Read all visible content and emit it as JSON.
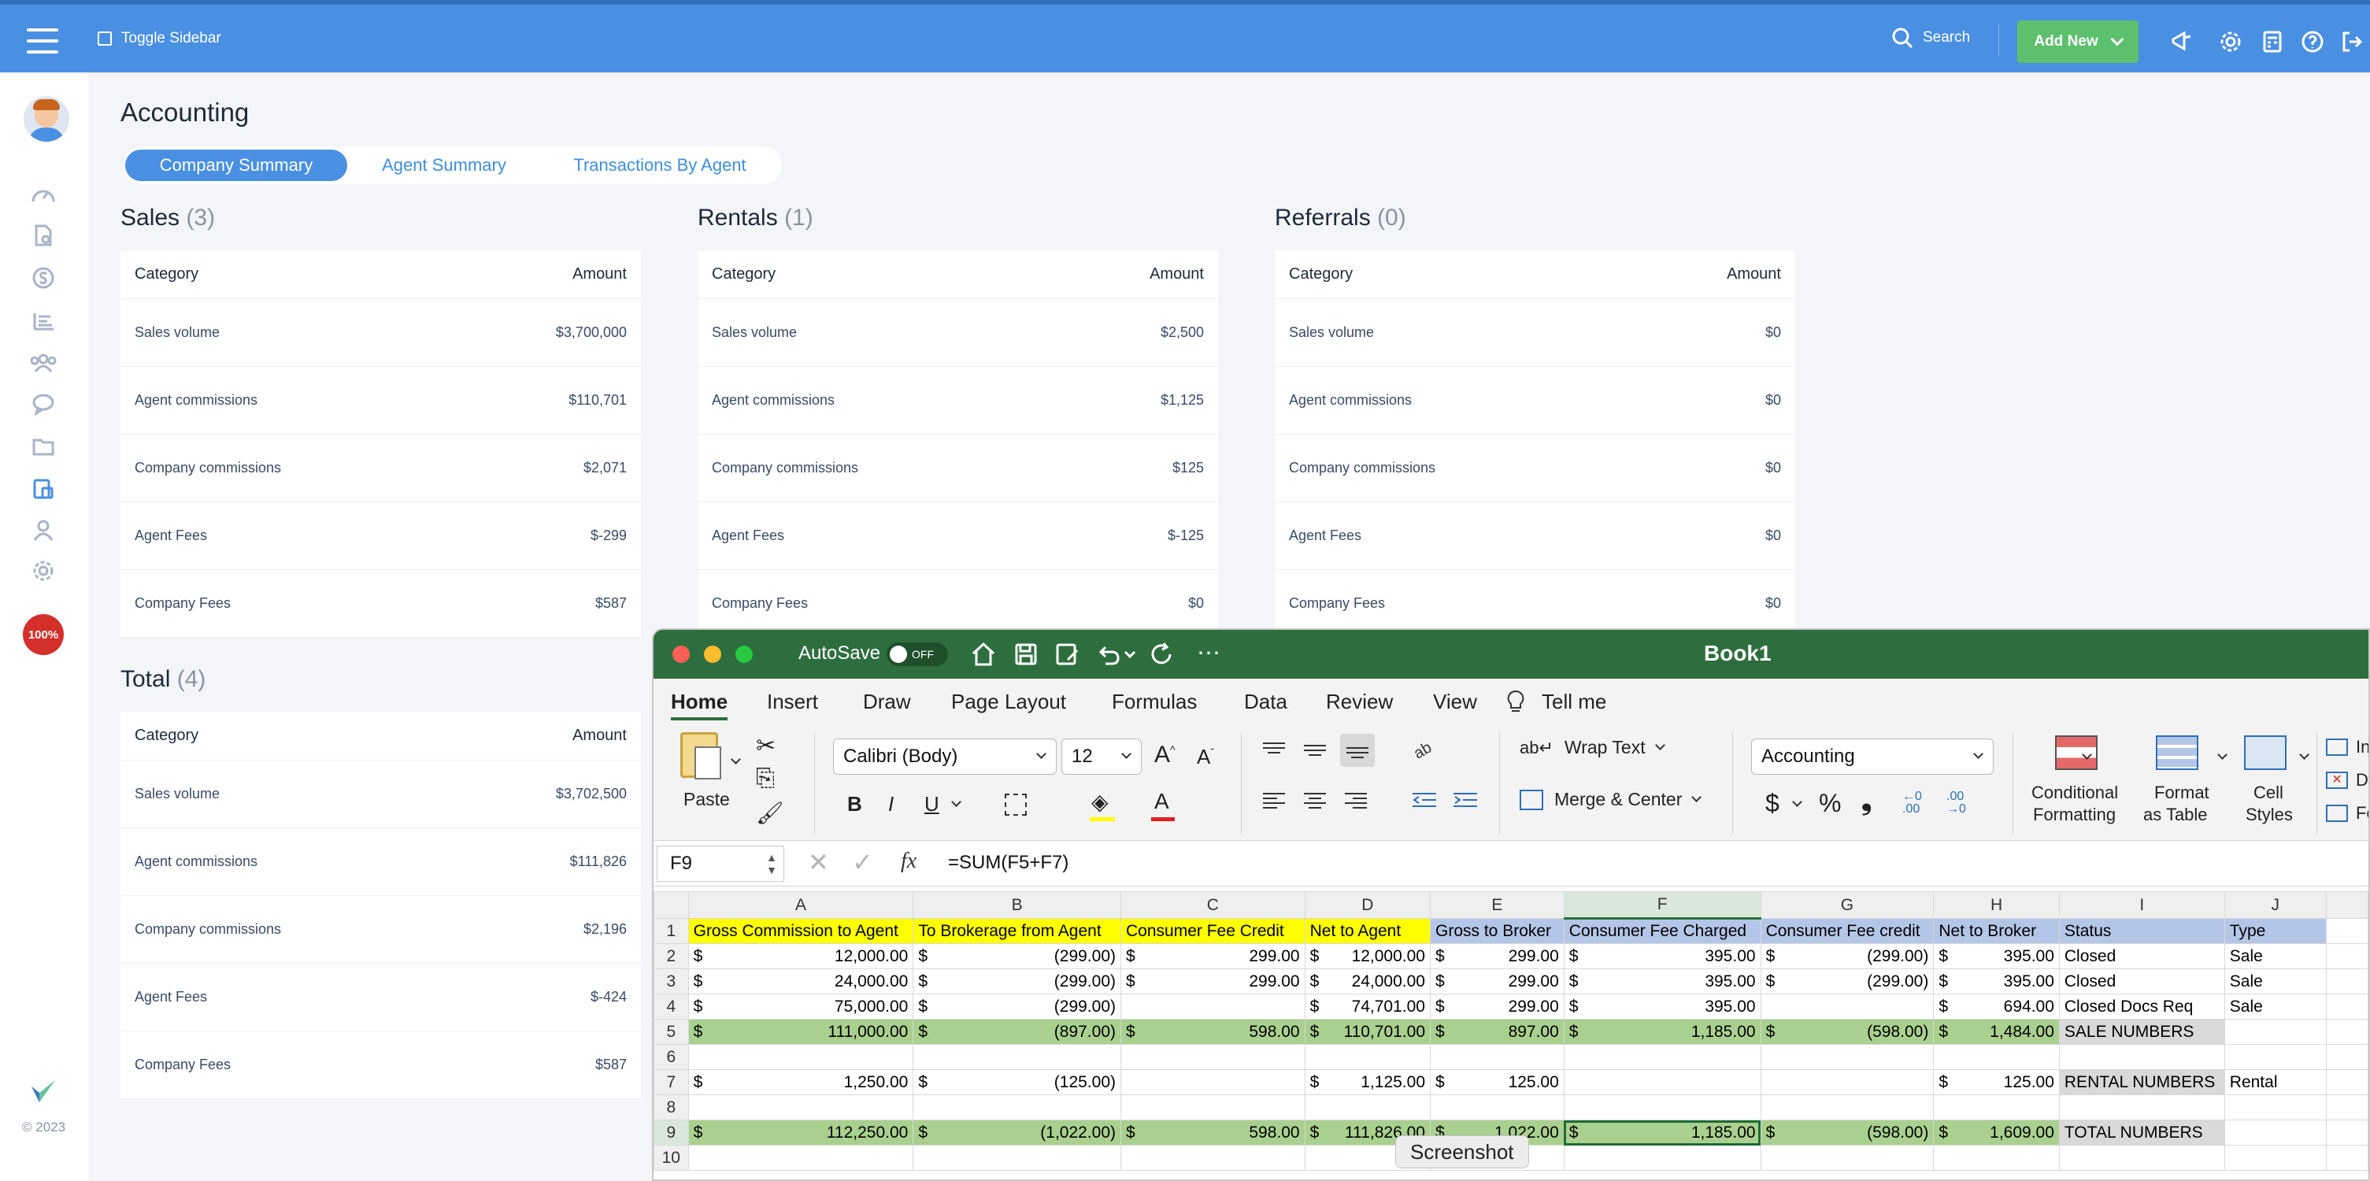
{
  "topbar": {
    "toggle_label": "Toggle Sidebar",
    "search_label": "Search",
    "add_new_label": "Add New"
  },
  "sidebar": {
    "progress_label": "100%",
    "copyright": "© 2023"
  },
  "page": {
    "title": "Accounting",
    "tabs": [
      {
        "label": "Company Summary",
        "active": true
      },
      {
        "label": "Agent Summary",
        "active": false
      },
      {
        "label": "Transactions By Agent",
        "active": false
      }
    ]
  },
  "cards": {
    "sales": {
      "title": "Sales",
      "count": "(3)",
      "head": [
        "Category",
        "Amount"
      ],
      "rows": [
        [
          "Sales volume",
          "$3,700,000"
        ],
        [
          "Agent commissions",
          "$110,701"
        ],
        [
          "Company commissions",
          "$2,071"
        ],
        [
          "Agent Fees",
          "$-299"
        ],
        [
          "Company Fees",
          "$587"
        ]
      ]
    },
    "rentals": {
      "title": "Rentals",
      "count": "(1)",
      "head": [
        "Category",
        "Amount"
      ],
      "rows": [
        [
          "Sales volume",
          "$2,500"
        ],
        [
          "Agent commissions",
          "$1,125"
        ],
        [
          "Company commissions",
          "$125"
        ],
        [
          "Agent Fees",
          "$-125"
        ],
        [
          "Company Fees",
          "$0"
        ]
      ]
    },
    "referrals": {
      "title": "Referrals",
      "count": "(0)",
      "head": [
        "Category",
        "Amount"
      ],
      "rows": [
        [
          "Sales volume",
          "$0"
        ],
        [
          "Agent commissions",
          "$0"
        ],
        [
          "Company commissions",
          "$0"
        ],
        [
          "Agent Fees",
          "$0"
        ],
        [
          "Company Fees",
          "$0"
        ]
      ]
    },
    "total": {
      "title": "Total",
      "count": "(4)",
      "head": [
        "Category",
        "Amount"
      ],
      "rows": [
        [
          "Sales volume",
          "$3,702,500"
        ],
        [
          "Agent commissions",
          "$111,826"
        ],
        [
          "Company commissions",
          "$2,196"
        ],
        [
          "Agent Fees",
          "$-424"
        ],
        [
          "Company Fees",
          "$587"
        ]
      ]
    }
  },
  "excel": {
    "title": "Book1",
    "autosave": "AutoSave",
    "autosave_state": "OFF",
    "menu": [
      "Home",
      "Insert",
      "Draw",
      "Page Layout",
      "Formulas",
      "Data",
      "Review",
      "View",
      "Tell me"
    ],
    "ribbon": {
      "paste": "Paste",
      "font": "Calibri (Body)",
      "size": "12",
      "wrap": "Wrap Text",
      "merge": "Merge & Center",
      "number_format": "Accounting",
      "cond_format": [
        "Conditional",
        "Formatting"
      ],
      "format_table": [
        "Format",
        "as Table"
      ],
      "cell_styles": [
        "Cell",
        "Styles"
      ],
      "insert": "Inse",
      "delete": "Dele",
      "format": "Forn"
    },
    "cell_ref": "F9",
    "formula": "=SUM(F5+F7)",
    "columns": [
      "A",
      "B",
      "C",
      "D",
      "E",
      "F",
      "G",
      "H",
      "I",
      "J"
    ],
    "rows": [
      {
        "n": "1",
        "cells": [
          "Gross Commission to Agent",
          "To Brokerage from Agent",
          "Consumer Fee Credit",
          "Net to Agent",
          "Gross to Broker",
          "Consumer Fee Charged",
          "Consumer Fee credit",
          "Net to Broker",
          "Status",
          "Type"
        ]
      },
      {
        "n": "2",
        "cells": [
          "12,000.00",
          "(299.00)",
          "299.00",
          "12,000.00",
          "299.00",
          "395.00",
          "(299.00)",
          "395.00",
          "Closed",
          "Sale"
        ]
      },
      {
        "n": "3",
        "cells": [
          "24,000.00",
          "(299.00)",
          "299.00",
          "24,000.00",
          "299.00",
          "395.00",
          "(299.00)",
          "395.00",
          "Closed",
          "Sale"
        ]
      },
      {
        "n": "4",
        "cells": [
          "75,000.00",
          "(299.00)",
          "",
          "74,701.00",
          "299.00",
          "395.00",
          "",
          "694.00",
          "Closed Docs Req",
          "Sale"
        ]
      },
      {
        "n": "5",
        "cells": [
          "111,000.00",
          "(897.00)",
          "598.00",
          "110,701.00",
          "897.00",
          "1,185.00",
          "(598.00)",
          "1,484.00",
          "SALE NUMBERS",
          ""
        ]
      },
      {
        "n": "6",
        "cells": [
          "",
          "",
          "",
          "",
          "",
          "",
          "",
          "",
          "",
          ""
        ]
      },
      {
        "n": "7",
        "cells": [
          "1,250.00",
          "(125.00)",
          "",
          "1,125.00",
          "125.00",
          "",
          "",
          "125.00",
          "RENTAL NUMBERS",
          "Rental"
        ]
      },
      {
        "n": "8",
        "cells": [
          "",
          "",
          "",
          "",
          "",
          "",
          "",
          "",
          "",
          ""
        ]
      },
      {
        "n": "9",
        "cells": [
          "112,250.00",
          "(1,022.00)",
          "598.00",
          "111,826.00",
          "1,022.00",
          "1,185.00",
          "(598.00)",
          "1,609.00",
          "TOTAL NUMBERS",
          ""
        ]
      },
      {
        "n": "10",
        "cells": [
          "",
          "",
          "",
          "",
          "",
          "",
          "",
          "",
          "",
          ""
        ]
      }
    ],
    "tooltip": "Screenshot"
  }
}
